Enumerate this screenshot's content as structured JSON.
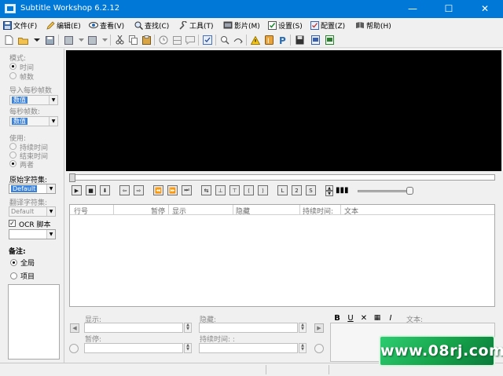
{
  "window": {
    "title": "Subtitle Workshop 6.2.12",
    "minimize": "—",
    "maximize": "☐",
    "close": "✕"
  },
  "menu": [
    {
      "label": "文件(F)",
      "icon": "save-icon"
    },
    {
      "label": "编辑(E)",
      "icon": "pencil-icon"
    },
    {
      "label": "查看(V)",
      "icon": "eye-icon"
    },
    {
      "label": "查找(C)",
      "icon": "magnifier-icon"
    },
    {
      "label": "工具(T)",
      "icon": "wrench-icon"
    },
    {
      "label": "影片(M)",
      "icon": "film-icon"
    },
    {
      "label": "设置(S)",
      "icon": "settings-icon"
    },
    {
      "label": "配置(Z)",
      "icon": "profile-icon"
    },
    {
      "label": "帮助(H)",
      "icon": "book-icon"
    }
  ],
  "left": {
    "mode_label": "模式:",
    "mode_options": [
      "时间",
      "帧数"
    ],
    "input_fps_label": "导入每秒帧数",
    "input_fps_value": "数值",
    "fps_label": "每秒帧数:",
    "fps_value": "数值",
    "use_label": "使用:",
    "use_options": [
      "持续时间",
      "结束时间",
      "两者"
    ],
    "orig_charset_label": "原始字符集:",
    "orig_charset_value": "Default",
    "trans_charset_label": "翻译字符集:",
    "trans_charset_value": "Default",
    "ocr_label": "OCR 脚本",
    "notes_label": "备注:",
    "notes_options": [
      "全局",
      "项目"
    ]
  },
  "grid": {
    "columns": [
      "行号",
      "暂停",
      "显示",
      "隐藏",
      "持续时间:",
      "文本"
    ]
  },
  "editor": {
    "show_label": "显示:",
    "hide_label": "隐藏:",
    "pause_label": "暂停:",
    "duration_label": "持续时间: :",
    "text_label": "文本:",
    "bold": "B",
    "italic": "I",
    "underline": "U"
  },
  "watermark": "www.08rj.com",
  "colors": {
    "titlebar": "#0078d7",
    "video": "#000000",
    "watermark_green": "#16a34a"
  }
}
